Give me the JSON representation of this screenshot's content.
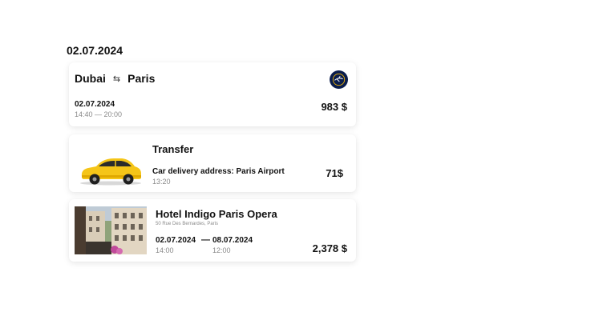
{
  "date_heading": "02.07.2024",
  "flight": {
    "from": "Dubai",
    "to": "Paris",
    "swap_glyph": "⇆",
    "airline_icon": "airline-crane-logo",
    "date": "02.07.2024",
    "time": "14:40 — 20:00",
    "price": "983 $"
  },
  "transfer": {
    "title": "Transfer",
    "address": "Car delivery address: Paris Airport",
    "time": "13:20",
    "price": "71$",
    "car_color": "#f5c518"
  },
  "hotel": {
    "name": "Hotel Indigo Paris Opera",
    "address": "50 Rue Des Bernardes, Paris",
    "checkin_date": "02.07.2024",
    "checkout_date": "08.07.2024",
    "dash": "—",
    "checkin_time": "14:00",
    "checkout_time": "12:00",
    "price": "2,378 $"
  }
}
